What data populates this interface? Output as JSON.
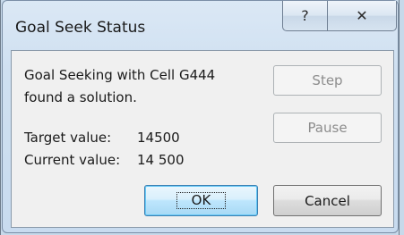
{
  "window": {
    "title": "Goal Seek Status",
    "help_icon": "?",
    "close_icon": "✕"
  },
  "message": {
    "line1": "Goal Seeking with Cell G444",
    "line2": "found a solution."
  },
  "values": {
    "target_label": "Target value:",
    "target_value": "14500",
    "current_label": "Current value:",
    "current_value": "14 500"
  },
  "buttons": {
    "step": "Step",
    "pause": "Pause",
    "ok": "OK",
    "cancel": "Cancel"
  }
}
